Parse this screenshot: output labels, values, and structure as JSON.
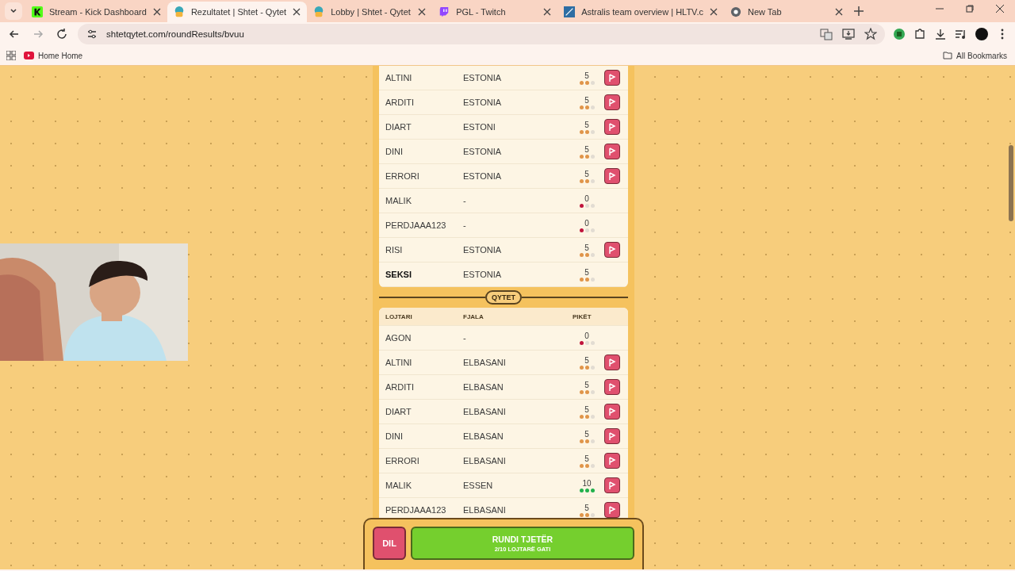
{
  "browser": {
    "tabs": [
      {
        "title": "Stream - Kick Dashboard",
        "kind": "kick",
        "selected": false
      },
      {
        "title": "Rezultatet | Shtet - Qytet",
        "kind": "sq",
        "selected": true
      },
      {
        "title": "Lobby | Shtet - Qytet",
        "kind": "sq",
        "selected": false
      },
      {
        "title": "PGL - Twitch",
        "kind": "twitch",
        "selected": false
      },
      {
        "title": "Astralis team overview | HLTV.c",
        "kind": "hltv",
        "selected": false
      },
      {
        "title": "New Tab",
        "kind": "chrome",
        "selected": false
      }
    ],
    "url": "shtetqytet.com/roundResults/bvuu",
    "bookmarks": [
      "Home Home"
    ],
    "all_bookmarks": "All Bookmarks"
  },
  "sections": [
    {
      "rows": [
        {
          "player": "ALTINI",
          "word": "ESTONIA",
          "points": "5",
          "stars": 2,
          "color": "#e0954a",
          "flagged": true,
          "self": false
        },
        {
          "player": "ARDITI",
          "word": "ESTONIA",
          "points": "5",
          "stars": 2,
          "color": "#e0954a",
          "flagged": true,
          "self": false
        },
        {
          "player": "DIART",
          "word": "ESTONI",
          "points": "5",
          "stars": 2,
          "color": "#e0954a",
          "flagged": true,
          "self": false
        },
        {
          "player": "DINI",
          "word": "ESTONIA",
          "points": "5",
          "stars": 2,
          "color": "#e0954a",
          "flagged": true,
          "self": false
        },
        {
          "player": "ERRORI",
          "word": "ESTONIA",
          "points": "5",
          "stars": 2,
          "color": "#e0954a",
          "flagged": true,
          "self": false
        },
        {
          "player": "MALIK",
          "word": "-",
          "points": "0",
          "stars": 1,
          "color": "#c0143c",
          "flagged": false,
          "self": false
        },
        {
          "player": "PERDJAAA123",
          "word": "-",
          "points": "0",
          "stars": 1,
          "color": "#c0143c",
          "flagged": false,
          "self": false
        },
        {
          "player": "RISI",
          "word": "ESTONIA",
          "points": "5",
          "stars": 2,
          "color": "#e0954a",
          "flagged": true,
          "self": false
        },
        {
          "player": "SEKSI",
          "word": "ESTONIA",
          "points": "5",
          "stars": 2,
          "color": "#e0954a",
          "flagged": false,
          "self": true
        }
      ]
    },
    {
      "label": "QYTET",
      "columns": [
        "LOJTARI",
        "FJALA",
        "PIKËT"
      ],
      "rows": [
        {
          "player": "AGON",
          "word": "-",
          "points": "0",
          "stars": 1,
          "color": "#c0143c",
          "flagged": false,
          "self": false
        },
        {
          "player": "ALTINI",
          "word": "ELBASANI",
          "points": "5",
          "stars": 2,
          "color": "#e0954a",
          "flagged": true,
          "self": false
        },
        {
          "player": "ARDITI",
          "word": "ELBASAN",
          "points": "5",
          "stars": 2,
          "color": "#e0954a",
          "flagged": true,
          "self": false
        },
        {
          "player": "DIART",
          "word": "ELBASANI",
          "points": "5",
          "stars": 2,
          "color": "#e0954a",
          "flagged": true,
          "self": false
        },
        {
          "player": "DINI",
          "word": "ELBASAN",
          "points": "5",
          "stars": 2,
          "color": "#e0954a",
          "flagged": true,
          "self": false
        },
        {
          "player": "ERRORI",
          "word": "ELBASANI",
          "points": "5",
          "stars": 2,
          "color": "#e0954a",
          "flagged": true,
          "self": false
        },
        {
          "player": "MALIK",
          "word": "ESSEN",
          "points": "10",
          "stars": 3,
          "color": "#22b14c",
          "flagged": true,
          "self": false
        },
        {
          "player": "PERDJAAA123",
          "word": "ELBASANI",
          "points": "5",
          "stars": 2,
          "color": "#e0954a",
          "flagged": true,
          "self": false
        }
      ]
    }
  ],
  "footer": {
    "leave": "DIL",
    "next": "RUNDI TJETËR",
    "next_sub": "2/10 LOJTARË GATI"
  }
}
